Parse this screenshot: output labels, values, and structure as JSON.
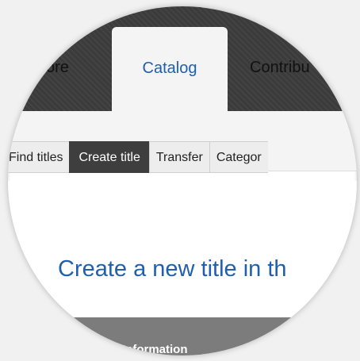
{
  "top_nav": {
    "tabs": [
      {
        "label": "ore",
        "active": false
      },
      {
        "label": "Catalog",
        "active": true
      },
      {
        "label": "Contribu",
        "active": false
      }
    ]
  },
  "sub_nav": {
    "tabs": [
      {
        "label": "Find titles",
        "active": false
      },
      {
        "label": "Create title",
        "active": true
      },
      {
        "label": "Transfer",
        "active": false
      },
      {
        "label": "Categor",
        "active": false
      }
    ]
  },
  "main": {
    "heading": "Create a new title in th",
    "section_label": "Information"
  },
  "colors": {
    "accent_blue": "#1f5fad",
    "nav_dark": "#3b3b3b",
    "active_subtab": "#3e3e3e"
  }
}
